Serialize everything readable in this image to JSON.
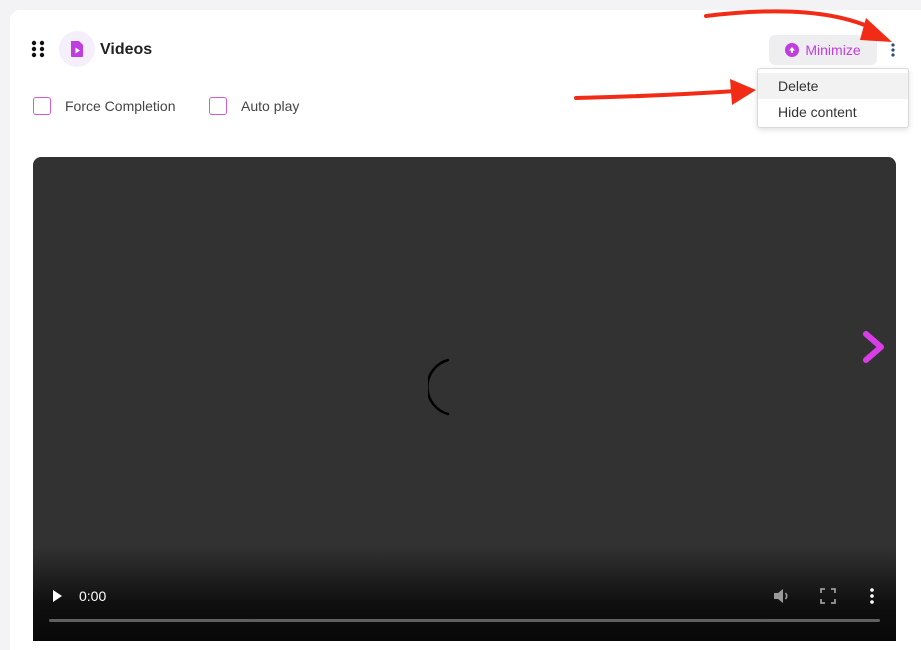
{
  "header": {
    "title": "Videos",
    "minimize_label": "Minimize"
  },
  "menu": {
    "items": [
      {
        "label": "Delete"
      },
      {
        "label": "Hide content"
      }
    ]
  },
  "options": {
    "force_completion_label": "Force Completion",
    "auto_play_label": "Auto play"
  },
  "player": {
    "time": "0:00"
  },
  "colors": {
    "accent": "#c03de0",
    "checkbox_border": "#d45bd6",
    "player_bg": "#323232",
    "annotation_arrow": "#f22b16"
  },
  "icons": [
    "drag-handle-icon",
    "video-icon",
    "minimize-icon",
    "kebab-menu-icon",
    "play-icon",
    "volume-icon",
    "fullscreen-icon",
    "more-options-icon",
    "chevron-right-icon",
    "loading-spinner-icon"
  ]
}
